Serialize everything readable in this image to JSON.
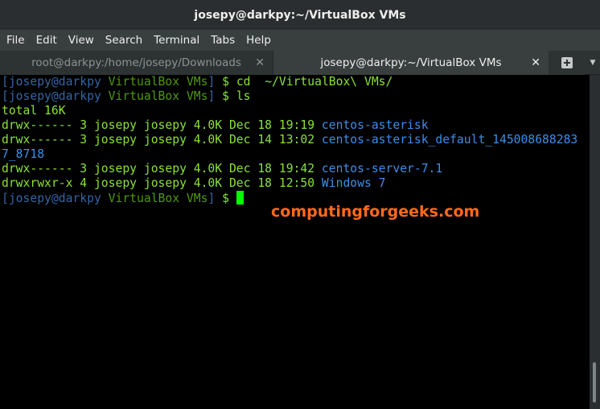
{
  "window": {
    "title": "josepy@darkpy:~/VirtualBox VMs"
  },
  "menu": [
    "File",
    "Edit",
    "View",
    "Search",
    "Terminal",
    "Tabs",
    "Help"
  ],
  "tabs": [
    {
      "label": "root@darkpy:/home/josepy/Downloads",
      "close": "✕"
    },
    {
      "label": "josepy@darkpy:~/VirtualBox VMs",
      "close": "✕"
    }
  ],
  "terminal": {
    "prompt": {
      "open": "[",
      "user": "josepy@darkpy",
      "dir": "VirtualBox VMs",
      "close": "]",
      "sigil": "$"
    },
    "commands": [
      "cd  ~/VirtualBox\\ VMs/",
      "ls"
    ],
    "total": "total 16K",
    "entries": [
      {
        "meta": "drwx------ 3 josepy josepy 4.0K Dec 18 19:19",
        "name": "centos-asterisk"
      },
      {
        "meta": "drwx------ 3 josepy josepy 4.0K Dec 14 13:02",
        "name": "centos-asterisk_default_145008688283",
        "name_cont": "7_8718"
      },
      {
        "meta": "drwx------ 3 josepy josepy 4.0K Dec 18 19:42",
        "name": "centos-server-7.1"
      },
      {
        "meta": "drwxrwxr-x 4 josepy josepy 4.0K Dec 18 12:50",
        "name": "Windows 7"
      }
    ]
  },
  "watermark": "computingforgeeks.com",
  "colors": {
    "prompt_blue": "#3465a4",
    "prompt_green": "#4e9a06",
    "text_green": "#8ae234",
    "dir_blue": "#3b8eea",
    "cursor": "#00ff00",
    "watermark": "#ff6a1a"
  }
}
